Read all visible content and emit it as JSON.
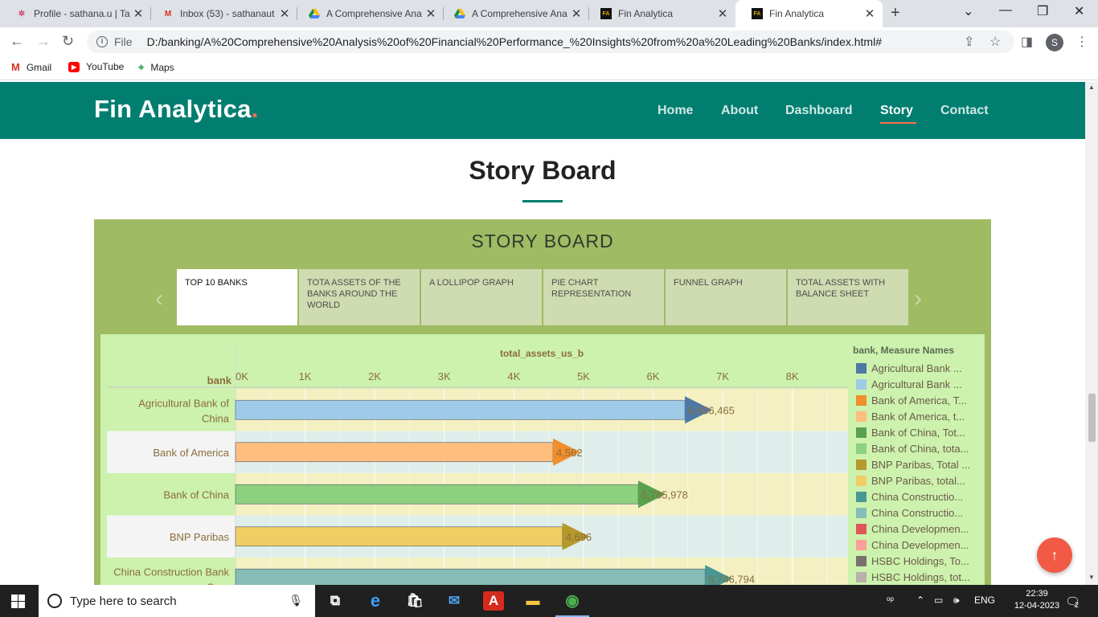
{
  "browser": {
    "tabs": [
      {
        "title": "Profile - sathana.u | Ta",
        "icon": "gear-icon",
        "active": false
      },
      {
        "title": "Inbox (53) - sathanaut",
        "icon": "gmail-icon",
        "active": false
      },
      {
        "title": "A Comprehensive Ana",
        "icon": "drive-icon",
        "active": false
      },
      {
        "title": "A Comprehensive Ana",
        "icon": "drive-icon",
        "active": false
      },
      {
        "title": "Fin Analytica",
        "icon": "fin-analytica-icon",
        "active": false
      },
      {
        "title": "Fin Analytica",
        "icon": "fin-analytica-icon",
        "active": true
      }
    ],
    "file_label": "File",
    "url": "D:/banking/A%20Comprehensive%20Analysis%20of%20Financial%20Performance_%20Insights%20from%20a%20Leading%20Banks/index.html#",
    "profile_initial": "S",
    "bookmarks": [
      {
        "label": "Gmail",
        "icon": "gmail-icon"
      },
      {
        "label": "YouTube",
        "icon": "youtube-icon"
      },
      {
        "label": "Maps",
        "icon": "maps-icon"
      }
    ]
  },
  "site": {
    "logo": "Fin Analytica",
    "logo_dot": ".",
    "nav": [
      "Home",
      "About",
      "Dashboard",
      "Story",
      "Contact"
    ],
    "active_nav": "Story",
    "section_title": "Story Board"
  },
  "story": {
    "title": "STORY BOARD",
    "points": [
      "TOP 10 BANKS",
      "TOTA ASSETS OF THE BANKS AROUND THE WORLD",
      "A LOLLIPOP GRAPH",
      "PIE CHART REPRESENTATION",
      "FUNNEL GRAPH",
      "TOTAL ASSETS WITH BALANCE SHEET"
    ],
    "active_index": 0
  },
  "legend": {
    "title": "bank, Measure Names",
    "items": [
      {
        "label": "Agricultural Bank ...",
        "color": "#4e79a7"
      },
      {
        "label": "Agricultural Bank ...",
        "color": "#a0cbe8"
      },
      {
        "label": "Bank of America, T...",
        "color": "#f28e2b"
      },
      {
        "label": "Bank of America, t...",
        "color": "#ffbe7d"
      },
      {
        "label": "Bank of China, Tot...",
        "color": "#59a14f"
      },
      {
        "label": "Bank of China, tota...",
        "color": "#8cd17d"
      },
      {
        "label": "BNP Paribas, Total ...",
        "color": "#b6992d"
      },
      {
        "label": "BNP Paribas, total...",
        "color": "#f1ce63"
      },
      {
        "label": "China Constructio...",
        "color": "#499894"
      },
      {
        "label": "China Constructio...",
        "color": "#86bcb6"
      },
      {
        "label": "China Developmen...",
        "color": "#e15759"
      },
      {
        "label": "China Developmen...",
        "color": "#ff9d9a"
      },
      {
        "label": "HSBC Holdings, To...",
        "color": "#79706e"
      },
      {
        "label": "HSBC Holdings, tot...",
        "color": "#bab0ac"
      }
    ]
  },
  "chart_data": {
    "type": "bar",
    "orientation": "horizontal",
    "title": "total_assets_us_b",
    "ylabel": "bank",
    "xlim": [
      0,
      8800
    ],
    "x_ticks": [
      "0K",
      "1K",
      "2K",
      "3K",
      "4K",
      "5K",
      "6K",
      "7K",
      "8K"
    ],
    "categories": [
      "Agricultural Bank of China",
      "Bank of America",
      "Bank of China",
      "BNP Paribas",
      "China Construction Bank Corp"
    ],
    "values": [
      6456.465,
      4562,
      5785.978,
      4696,
      6746.794
    ],
    "labels": [
      "6,456,465",
      "4,562",
      "5,785,978",
      "4,696",
      "6,746,794"
    ],
    "arrow_colors": [
      "#4e79a7",
      "#f28e2b",
      "#59a14f",
      "#b6992d",
      "#499894"
    ],
    "bar_colors": [
      "#a0cbe8",
      "#ffbe7d",
      "#8cd17d",
      "#f1ce63",
      "#86bcb6"
    ],
    "row_colors": [
      "#f4f0c2",
      "#dfeeea",
      "#f4f0c2",
      "#dfeeea",
      "#f4f0c2"
    ],
    "grid": true
  },
  "taskbar": {
    "search_placeholder": "Type here to search",
    "apps": [
      {
        "name": "task-view-icon",
        "glyph": "⧉",
        "running": false
      },
      {
        "name": "edge-icon",
        "glyph": "e",
        "running": false
      },
      {
        "name": "store-icon",
        "glyph": "🛍",
        "running": false
      },
      {
        "name": "mail-icon",
        "glyph": "✉",
        "running": false
      },
      {
        "name": "acrobat-icon",
        "glyph": "A",
        "running": false
      },
      {
        "name": "file-explorer-icon",
        "glyph": "▬",
        "running": false
      },
      {
        "name": "chrome-icon",
        "glyph": "◉",
        "running": true
      }
    ],
    "language": "ENG",
    "time": "22:39",
    "date": "12-04-2023",
    "notification_count": "2"
  }
}
